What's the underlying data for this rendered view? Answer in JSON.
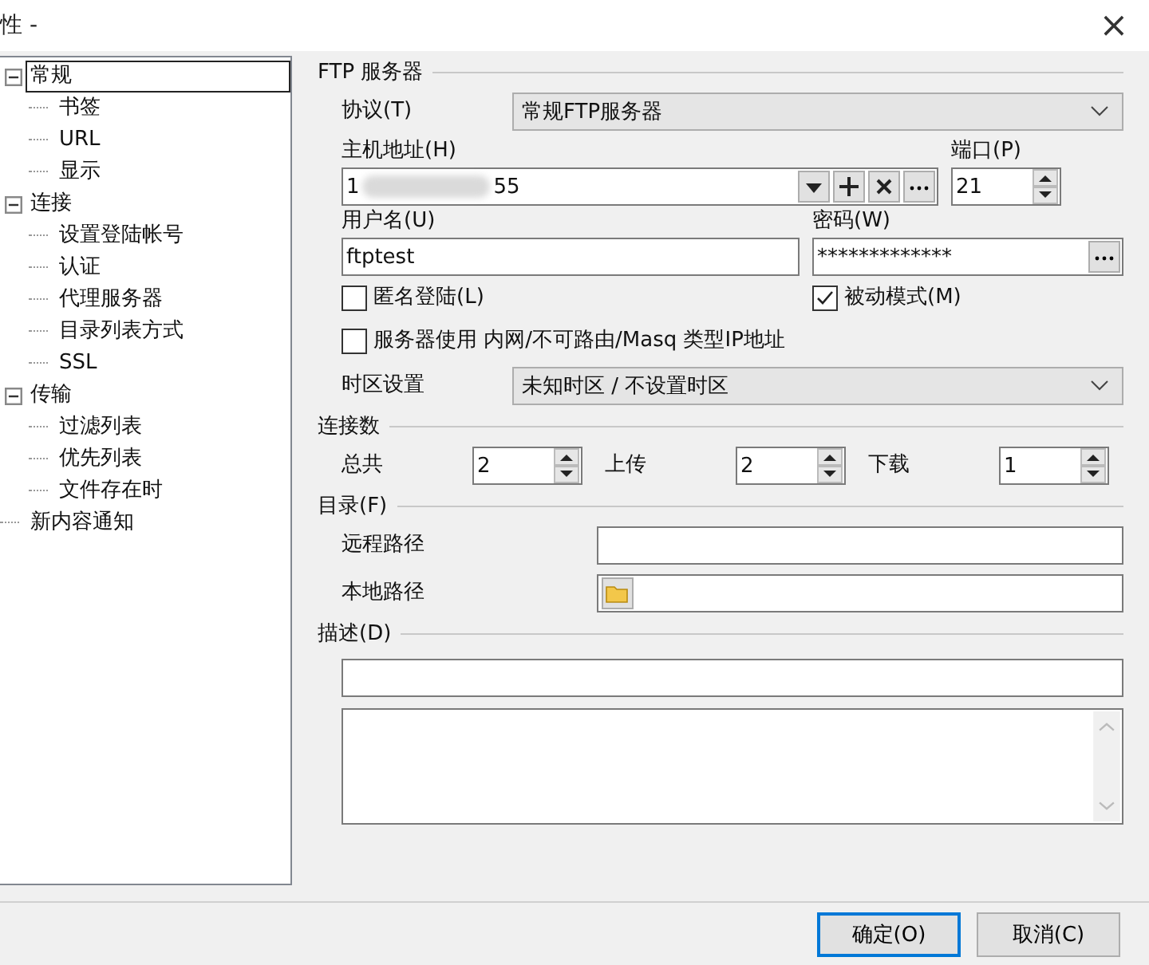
{
  "window": {
    "title": "性 -",
    "close": "×"
  },
  "tree": [
    {
      "label": "常规",
      "selected": true,
      "expanded": true,
      "children": [
        {
          "label": "书签",
          "selected": false
        },
        {
          "label": "URL",
          "selected": false
        },
        {
          "label": "显示",
          "selected": false
        }
      ]
    },
    {
      "label": "连接",
      "selected": false,
      "expanded": true,
      "children": [
        {
          "label": "设置登陆帐号",
          "selected": false
        },
        {
          "label": "认证",
          "selected": false
        },
        {
          "label": "代理服务器",
          "selected": false
        },
        {
          "label": "目录列表方式",
          "selected": false
        },
        {
          "label": "SSL",
          "selected": false
        }
      ]
    },
    {
      "label": "传输",
      "selected": false,
      "expanded": true,
      "children": [
        {
          "label": "过滤列表",
          "selected": false
        },
        {
          "label": "优先列表",
          "selected": false
        },
        {
          "label": "文件存在时",
          "selected": false
        }
      ]
    },
    {
      "label": "新内容通知",
      "selected": false
    }
  ],
  "ftp_server": {
    "title": "FTP 服务器",
    "protocol": {
      "label": "协议(T)",
      "value": "常规FTP服务器"
    },
    "host": {
      "label": "主机地址(H)",
      "value_start": "1",
      "value_end": "55"
    },
    "port": {
      "label": "端口(P)",
      "value": "21"
    },
    "username": {
      "label": "用户名(U)",
      "value": "ftptest"
    },
    "password": {
      "label": "密码(W)",
      "value": "*************"
    },
    "anonymous": {
      "label": "匿名登陆(L)",
      "checked": false
    },
    "passive": {
      "label": "被动模式(M)",
      "checked": true
    },
    "private_ip": {
      "label": "服务器使用 内网/不可路由/Masq 类型IP地址",
      "checked": false
    },
    "timezone": {
      "label": "时区设置",
      "value": "未知时区 / 不设置时区"
    }
  },
  "connections": {
    "title": "连接数",
    "fields": [
      {
        "label": "总共",
        "value": "2"
      },
      {
        "label": "上传",
        "value": "2"
      },
      {
        "label": "下载",
        "value": "1"
      }
    ]
  },
  "directory": {
    "title": "目录(F)",
    "remote": {
      "label": "远程路径"
    },
    "local": {
      "label": "本地路径"
    }
  },
  "description": {
    "title": "描述(D)"
  },
  "buttons": [
    {
      "label": "确定(O)",
      "default": true
    },
    {
      "label": "取消(C)",
      "default": false
    }
  ]
}
